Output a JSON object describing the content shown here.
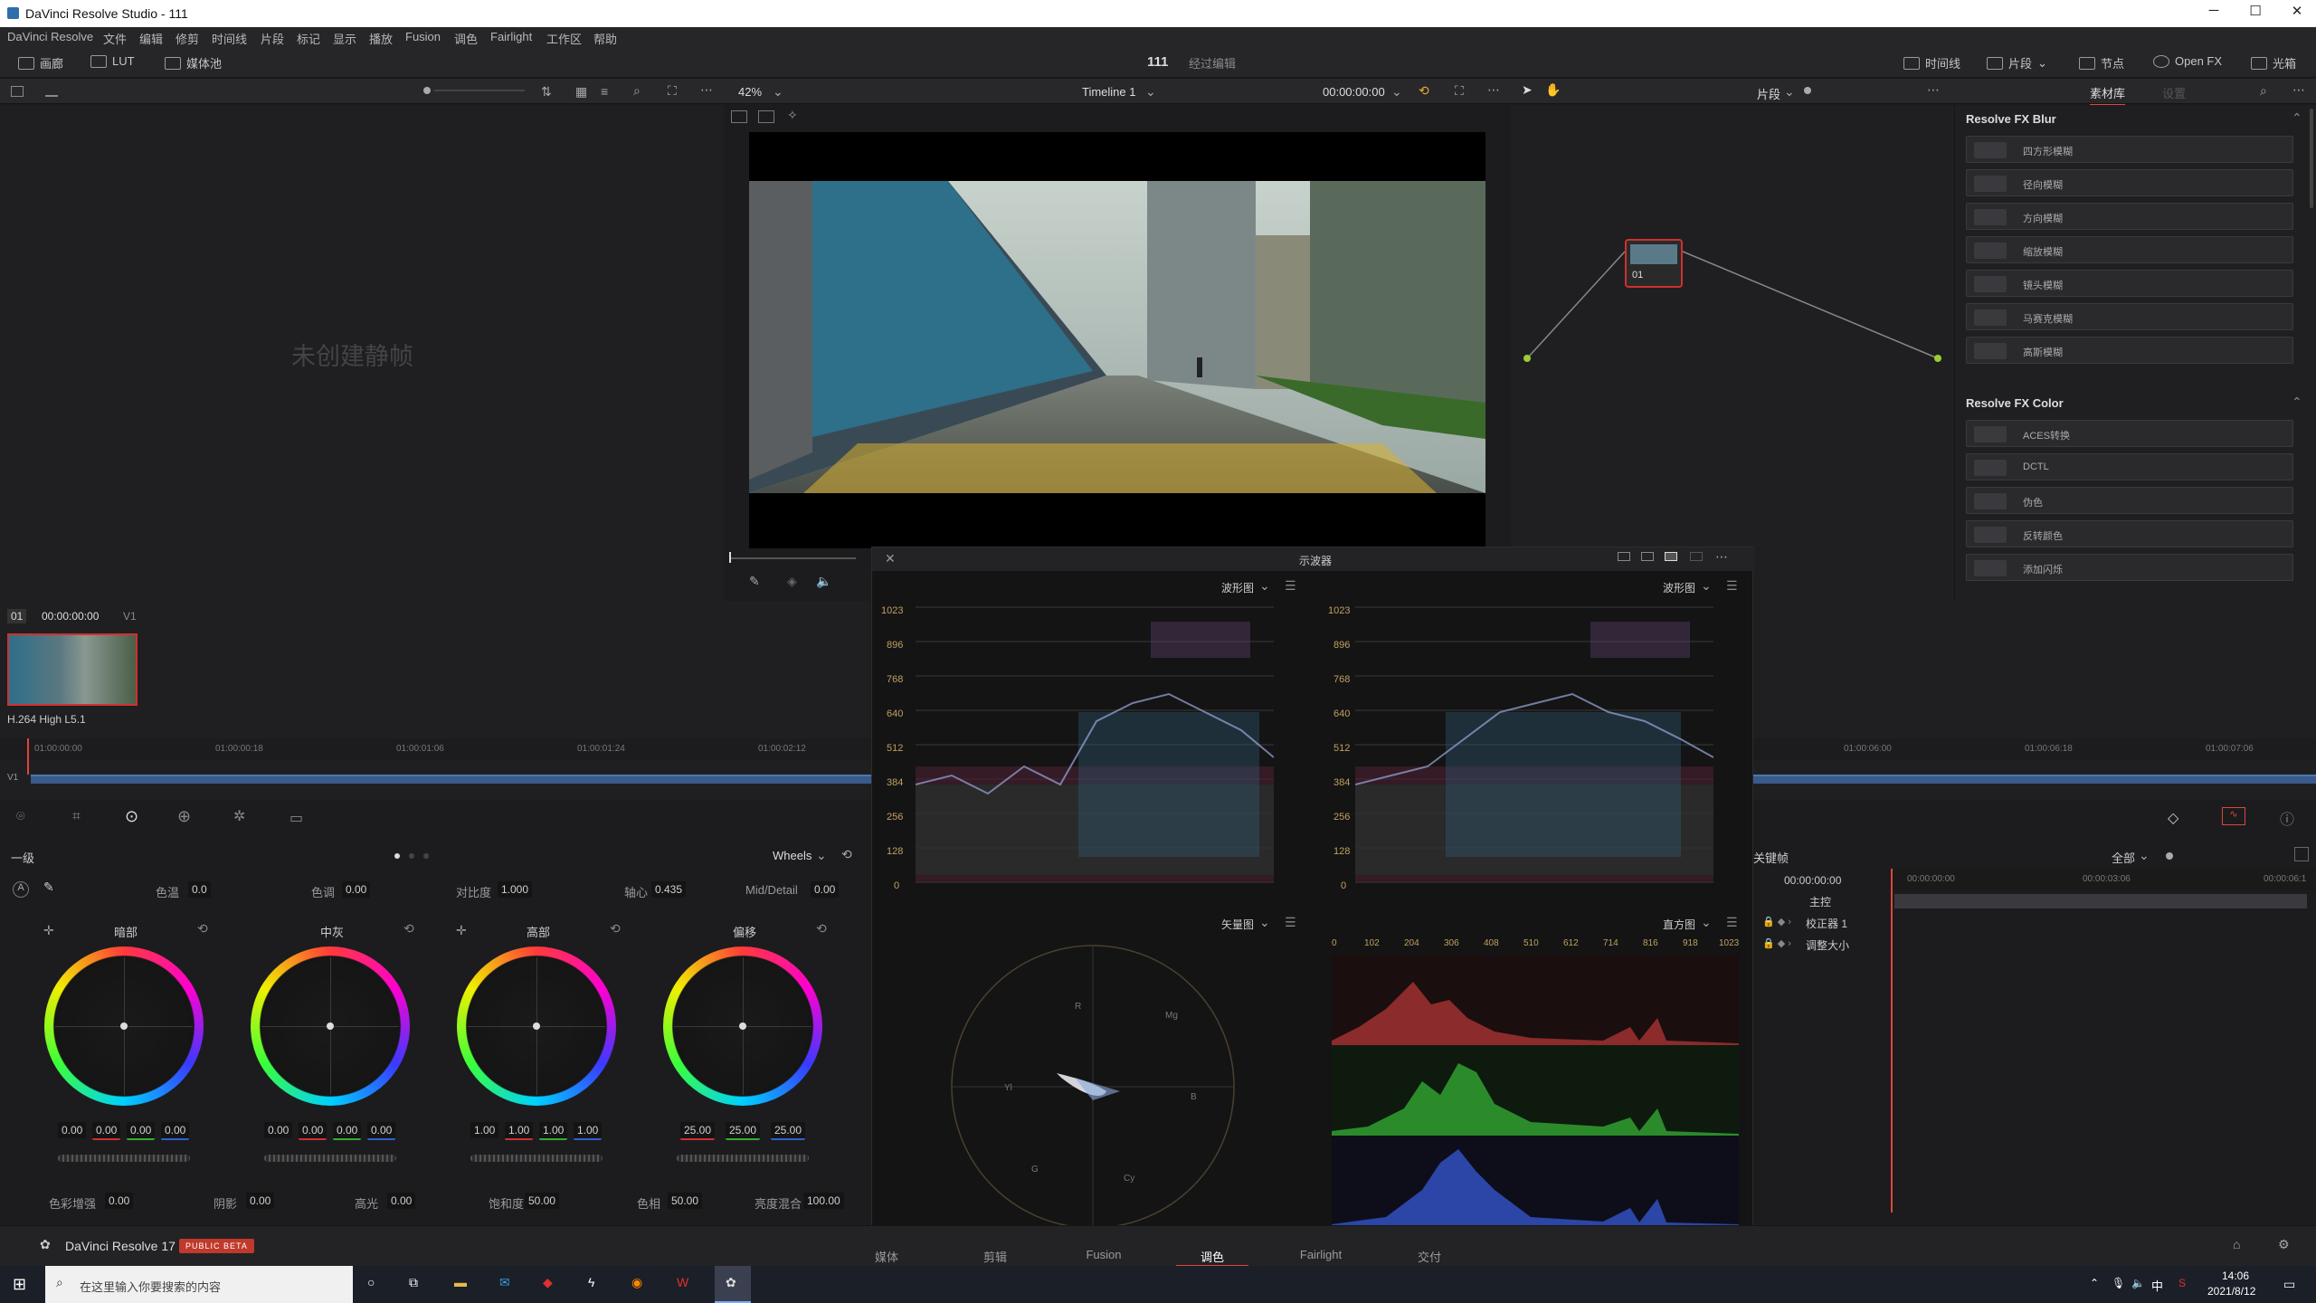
{
  "titlebar": {
    "title": "DaVinci Resolve Studio - 111",
    "min": "─",
    "max": "☐",
    "close": "✕"
  },
  "menu": [
    "DaVinci Resolve",
    "文件",
    "编辑",
    "修剪",
    "时间线",
    "片段",
    "标记",
    "显示",
    "播放",
    "Fusion",
    "调色",
    "Fairlight",
    "工作区",
    "帮助"
  ],
  "toolbar": {
    "gallery": "画廊",
    "lut": "LUT",
    "media_pool": "媒体池",
    "project": "111",
    "status": "经过编辑",
    "timeline": "时间线",
    "clips": "片段",
    "nodes": "节点",
    "openfx": "Open FX",
    "lightbox": "光箱"
  },
  "viewer": {
    "zoom": "42%",
    "timeline_name": "Timeline 1",
    "timecode": "00:00:00:00",
    "clip_dd": "片段",
    "tab_library": "素材库",
    "tab_settings": "设置"
  },
  "gallery": {
    "empty": "未创建静帧"
  },
  "fx": {
    "blur_title": "Resolve FX Blur",
    "blur_items": [
      "四方形模糊",
      "径向模糊",
      "方向模糊",
      "缩放模糊",
      "镜头模糊",
      "马赛克模糊",
      "高斯模糊"
    ],
    "color_title": "Resolve FX Color",
    "color_items": [
      "ACES转换",
      "DCTL",
      "伪色",
      "反转颜色",
      "添加闪烁"
    ]
  },
  "node": {
    "label": "01"
  },
  "clips": {
    "clip_num": "01",
    "timecode": "00:00:00:00",
    "track": "V1",
    "codec": "H.264 High L5.1"
  },
  "ruler": [
    "01:00:00:00",
    "01:00:00:18",
    "01:00:01:06",
    "01:00:01:24",
    "01:00:02:12",
    "01:00:06:00",
    "01:00:06:18",
    "01:00:07:06"
  ],
  "scopes": {
    "title": "示波器",
    "wf1": "波形图",
    "wf2": "波形图",
    "vec": "矢量图",
    "hist": "直方图",
    "y_labels": [
      "1023",
      "896",
      "768",
      "640",
      "512",
      "384",
      "256",
      "128",
      "0"
    ],
    "hist_labels": [
      "0",
      "102",
      "204",
      "306",
      "408",
      "510",
      "612",
      "714",
      "816",
      "918",
      "1023"
    ],
    "vec_labels": [
      "R",
      "Mg",
      "B",
      "Cy",
      "G",
      "Yl"
    ]
  },
  "primaries": {
    "mode": "一级",
    "wheels_mode": "Wheels",
    "temp_label": "色温",
    "temp": "0.0",
    "tint_label": "色调",
    "tint": "0.00",
    "contrast_label": "对比度",
    "contrast": "1.000",
    "pivot_label": "轴心",
    "pivot": "0.435",
    "md_label": "Mid/Detail",
    "md": "0.00",
    "wheel_names": [
      "暗部",
      "中灰",
      "高部",
      "偏移"
    ],
    "lift": [
      "0.00",
      "0.00",
      "0.00",
      "0.00"
    ],
    "gamma": [
      "0.00",
      "0.00",
      "0.00",
      "0.00"
    ],
    "gain": [
      "1.00",
      "1.00",
      "1.00",
      "1.00"
    ],
    "offset": [
      "25.00",
      "25.00",
      "25.00"
    ],
    "color_boost_label": "色彩增强",
    "color_boost": "0.00",
    "shadows_label": "阴影",
    "shadows": "0.00",
    "highlights_label": "高光",
    "highlights": "0.00",
    "sat_label": "饱和度",
    "sat": "50.00",
    "hue_label": "色相",
    "hue": "50.00",
    "lummix_label": "亮度混合",
    "lummix": "100.00"
  },
  "keyframes": {
    "title": "关键帧",
    "all": "全部",
    "tc1": "00:00:00:00",
    "tc2": "00:00:00:00",
    "tc3": "00:00:03:06",
    "tc4": "00:00:06:1",
    "master": "主控",
    "corr": "校正器 1",
    "resize": "调整大小"
  },
  "pages": [
    "媒体",
    "剪辑",
    "Fusion",
    "调色",
    "Fairlight",
    "交付"
  ],
  "brand": {
    "name": "DaVinci Resolve 17",
    "badge": "PUBLIC BETA"
  },
  "taskbar": {
    "search": "在这里输入你要搜索的内容",
    "time": "14:06",
    "date": "2021/8/12",
    "ime": "中"
  },
  "colors": {
    "accent": "#e0443c",
    "bg": "#1c1c1e"
  }
}
